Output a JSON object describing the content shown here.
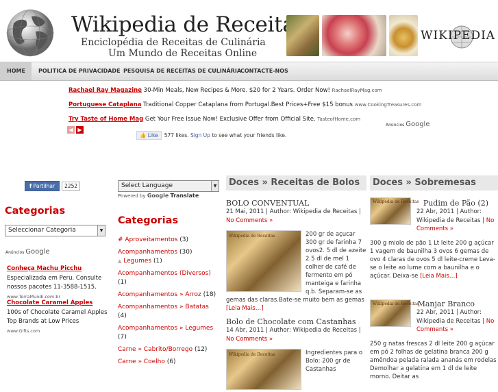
{
  "header": {
    "title": "Wikipedia de Receitas",
    "tagline_1": "Enciclopédia de Receitas de Culinária",
    "tagline_2": "Um Mundo de Receitas Online",
    "wiki_logo_text": "WIKIPEDIA"
  },
  "nav": {
    "items": [
      {
        "label": "HOME"
      },
      {
        "label": "POLITICA DE PRIVACIDADE"
      },
      {
        "label": "PESQUISA DE RECEITAS DE CULINÁRIA"
      },
      {
        "label": "CONTACTE-NOS"
      }
    ]
  },
  "top_ads": [
    {
      "title": "Rachael Ray Magazine",
      "text": "30-Min Meals, New Recipes & More. $20 for 2 Years. Order Now!",
      "url": "RachaelRayMag.com"
    },
    {
      "title": "Portuguese Cataplana",
      "text": "Traditional Copper Cataplana from Portugal.Best Prices+Free $15 bonus",
      "url": "www.CookingTreasures.com"
    },
    {
      "title": "Try Taste of Home Mag",
      "text": "Get Your Free Issue Now! Exclusive Offer from Official Site.",
      "url": "TasteofHome.com"
    }
  ],
  "ads_label": "Anúncios",
  "ads_brand": "Google",
  "fb": {
    "like_label": "Like",
    "likes_text": "577 likes.",
    "signup_label": "Sign Up",
    "signup_text": "to see what your friends like."
  },
  "left": {
    "share_label": "Partilhar",
    "share_count": "2252",
    "categories_heading": "Categorias",
    "select_value": "Seleccionar Categoria",
    "ads": [
      {
        "title": "Conheça Machu Picchu",
        "text": "Especializada em Peru. Consulte nossos pacotes 11-3588-1515.",
        "url": "www.TerraMundi.com.br"
      },
      {
        "title": "Chocolate Caramel Apples",
        "text": "100s of Chocolate Caramel Apples Top Brands at Low Prices",
        "url": "www.Gifts.com"
      }
    ]
  },
  "mid": {
    "lang_select": "Select Language",
    "powered_by": "Powered by",
    "google": "Google",
    "translate": "Translate",
    "categories_heading": "Categorias",
    "categories": [
      {
        "name": "# Aproveitamentos",
        "count": "(3)"
      },
      {
        "name": "Acompanhamentos",
        "count": "(30)"
      },
      {
        "name": "Legumes",
        "count": "(1)"
      },
      {
        "name": "Acompanhamentos (Diversos)",
        "count": "(1)"
      },
      {
        "name": "Acompanhamentos » Arroz",
        "count": "(18)"
      },
      {
        "name": "Acompanhamentos » Batatas",
        "count": "(4)"
      },
      {
        "name": "Acompanhamentos » Legumes",
        "count": "(7)"
      },
      {
        "name": "Carne » Cabrito/Borrego",
        "count": "(12)"
      },
      {
        "name": "Carne » Coelho",
        "count": "(6)"
      }
    ]
  },
  "posts_col1": {
    "heading": "Doces » Receitas de Bolos",
    "posts": [
      {
        "title": "BOLO CONVENTUAL",
        "date": "21 Mai, 2011",
        "author_prefix": "| Author: Wikipedia de Receitas |",
        "comments": "No Comments »",
        "thumb_label": "Wikipedia de Receitas",
        "body": "200 gr de açucar 300 gr de farinha 7 ovos2. 5 dl de azeite 2.5 dl de mel 1 colher de café de fermento em pó manteiga e farinha q.b. Separam-se as gemas das claras.Bate-se muito bem as gemas",
        "more": "[Leia Mais…]"
      },
      {
        "title": "Bolo de Chocolate com Castanhas",
        "date": "14 Abr, 2011",
        "author_prefix": "| Author: Wikipedia de Receitas |",
        "comments": "No Comments »",
        "thumb_label": "Wikipedia de Receitas",
        "body": "Ingredientes para o Bolo: 200 gr de Castanhas",
        "more": ""
      }
    ]
  },
  "posts_col2": {
    "heading": "Doces » Sobremesas",
    "posts": [
      {
        "title": "Pudim de Pão (2)",
        "date": "22 Abr, 2011",
        "author_prefix": "| Author: Wikipedia de Receitas |",
        "comments": "No Comments »",
        "thumb_label": "Wikipedia de Receitas",
        "body": "300 g miolo de pão 1 Lt leite 200 g açúcar 1 vagem de baunilha 3 ovos 6 gemas de ovo 4 claras de ovos 5 dl leite-creme Leva-se o leite ao lume com a baunilha e o açúcar. Deixa-se",
        "more": "[Leia Mais…]"
      },
      {
        "title": "Manjar Branco",
        "date": "22 Abr, 2011",
        "author_prefix": "| Author: Wikipedia de Receitas |",
        "comments": "No Comments »",
        "thumb_label": "Wikipedia de Receitas",
        "body": "250 g natas frescas 2 dl leite 200 g açúcar em pó 2 folhas de gelatina branca 200 g amêndoa pelada ralada ananás em rodelas Demolhar a gelatina em 1 dl de leite morno. Deitar as",
        "more": ""
      }
    ]
  },
  "colors": {
    "accent_red": "#cc0000",
    "nav_bg": "#dcdcdc",
    "fb_blue": "#3b5998"
  }
}
